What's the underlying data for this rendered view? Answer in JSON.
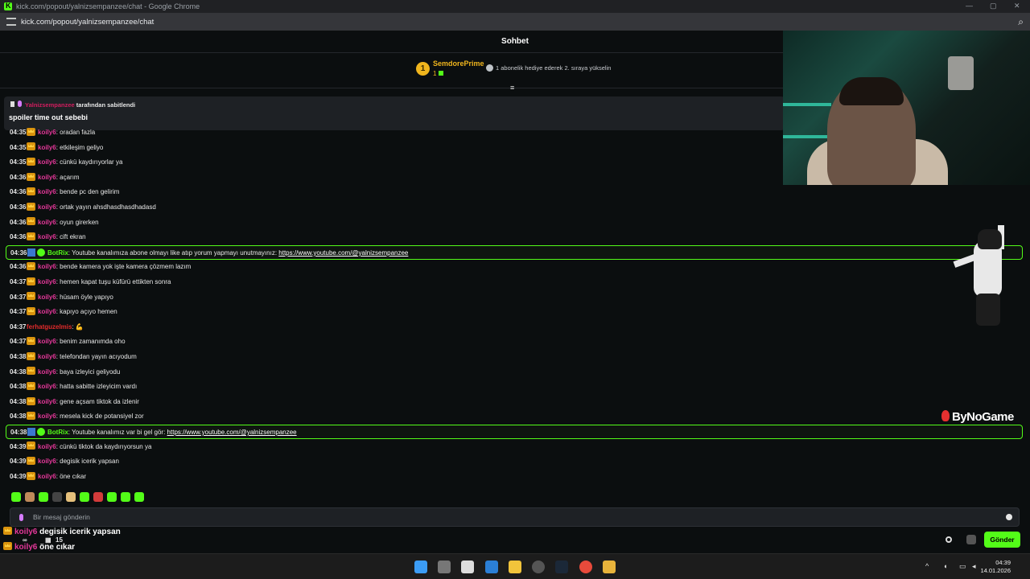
{
  "window": {
    "title": "kick.com/popout/yalnizsempanzee/chat - Google Chrome",
    "url": "kick.com/popout/yalnizsempanzee/chat"
  },
  "chat_header": {
    "title": "Sohbet"
  },
  "top_gifter": {
    "rank": "1",
    "name": "SemdorePrime",
    "count": "1",
    "promo": "1 abonelik hediye ederek 2. sıraya yükselin"
  },
  "pinned": {
    "by_user": "Yalnizsempanzee",
    "by_suffix": "tarafından sabitlendi",
    "message": "spoiler time out sebebi"
  },
  "messages": [
    {
      "time": "04:35",
      "user": "koily6",
      "text": "oradan fazla",
      "type": "sub"
    },
    {
      "time": "04:35",
      "user": "koily6",
      "text": "etkileşim geliyo",
      "type": "sub"
    },
    {
      "time": "04:35",
      "user": "koily6",
      "text": "cünkü kaydırıyorlar ya",
      "type": "sub"
    },
    {
      "time": "04:36",
      "user": "koily6",
      "text": "açarım",
      "type": "sub"
    },
    {
      "time": "04:36",
      "user": "koily6",
      "text": "bende pc den gelirim",
      "type": "sub"
    },
    {
      "time": "04:36",
      "user": "koily6",
      "text": "ortak yayın ahsdhasdhasdhadasd",
      "type": "sub"
    },
    {
      "time": "04:36",
      "user": "koily6",
      "text": "oyun girerken",
      "type": "sub"
    },
    {
      "time": "04:36",
      "user": "koily6",
      "text": "cift ekran",
      "type": "sub"
    },
    {
      "time": "04:36",
      "user": "BotRix",
      "text": "Youtube kanalımıza abone olmayı like atıp yorum yapmayı unutmayınız: ",
      "link": "https://www.youtube.com/@yalnizsempanzee",
      "type": "bot"
    },
    {
      "time": "04:36",
      "user": "koily6",
      "text": "bende kamera yok işte kamera çözmem lazım",
      "type": "sub"
    },
    {
      "time": "04:37",
      "user": "koily6",
      "text": "hemen kapat tuşu küfürü ettikten sonra",
      "type": "sub"
    },
    {
      "time": "04:37",
      "user": "koily6",
      "text": "hüsam öyle yapıyo",
      "type": "sub"
    },
    {
      "time": "04:37",
      "user": "koily6",
      "text": "kapıyo açıyo hemen",
      "type": "sub"
    },
    {
      "time": "04:37",
      "user": "ferhatguzelmis",
      "text": "💪",
      "type": "plain"
    },
    {
      "time": "04:37",
      "user": "koily6",
      "text": "benim zamanımda oho",
      "type": "sub"
    },
    {
      "time": "04:38",
      "user": "koily6",
      "text": "telefondan yayın acıyodum",
      "type": "sub"
    },
    {
      "time": "04:38",
      "user": "koily6",
      "text": "baya izleyici geliyodu",
      "type": "sub"
    },
    {
      "time": "04:38",
      "user": "koily6",
      "text": "hatta sabitte izleyicim vardı",
      "type": "sub"
    },
    {
      "time": "04:38",
      "user": "koily6",
      "text": "gene açsam tiktok da izlenir",
      "type": "sub"
    },
    {
      "time": "04:38",
      "user": "koily6",
      "text": "mesela kick de potansiyel zor",
      "type": "sub"
    },
    {
      "time": "04:38",
      "user": "BotRix",
      "text": "Youtube kanalımız var bi gel gör: ",
      "link": "https://www.youtube.com/@yalnizsempanzee",
      "type": "bot"
    },
    {
      "time": "04:39",
      "user": "koily6",
      "text": "cünkü tiktok da kaydırıyorsun ya",
      "type": "sub"
    },
    {
      "time": "04:39",
      "user": "koily6",
      "text": "degisik icerik yapsan",
      "type": "sub"
    },
    {
      "time": "04:39",
      "user": "koily6",
      "text": "öne cıkar",
      "type": "sub"
    }
  ],
  "emote_colors": [
    "#53fc18",
    "#c08a5a",
    "#53fc18",
    "#444444",
    "#e5c07b",
    "#53fc18",
    "#d33b3b",
    "#53fc18",
    "#53fc18",
    "#53fc18"
  ],
  "input": {
    "placeholder": "Bir mesaj gönderin"
  },
  "overlay": [
    {
      "user": "koily6",
      "text": " degisik icerik yapsan"
    },
    {
      "user": "koily6",
      "text": " öne cıkar"
    }
  ],
  "stats": {
    "infinite": "∞",
    "count": "15"
  },
  "send_label": "Gönder",
  "watermark": "ByNoGame",
  "taskbar": {
    "time": "04:39",
    "date": "14.01.2026"
  },
  "colors": {
    "accent": "#53fc18",
    "sub_user": "#e5389a",
    "gold": "#f0b51d"
  }
}
